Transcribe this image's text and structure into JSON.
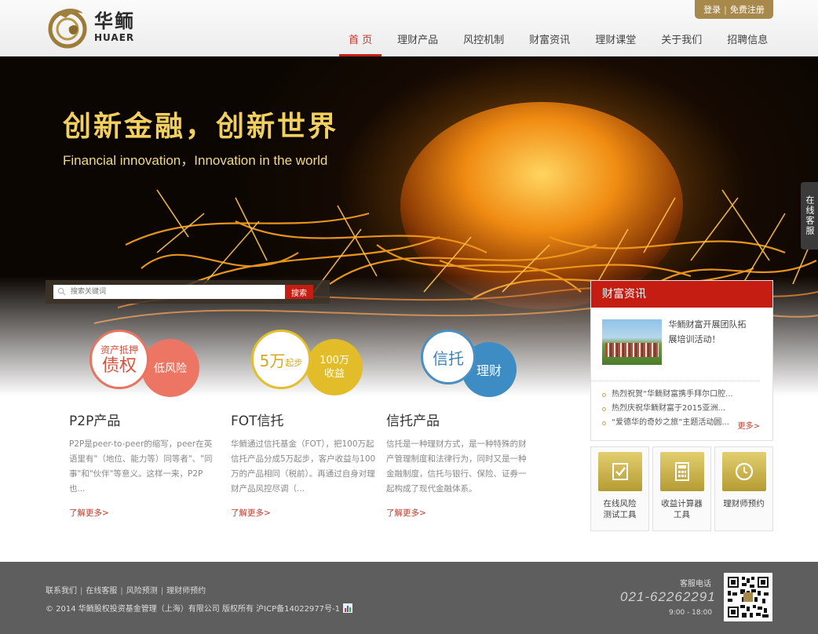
{
  "brand": {
    "name_cn": "华鲕",
    "name_en": "HUAER"
  },
  "auth": {
    "login": "登录",
    "separator": "|",
    "register": "免费注册"
  },
  "nav": [
    {
      "label": "首 页",
      "active": true
    },
    {
      "label": "理财产品"
    },
    {
      "label": "风控机制"
    },
    {
      "label": "财富资讯"
    },
    {
      "label": "理财课堂"
    },
    {
      "label": "关于我们"
    },
    {
      "label": "招聘信息"
    }
  ],
  "banner": {
    "title": "创新金融，创新世界",
    "subtitle": "Financial innovation，Innovation in the world"
  },
  "side_service": {
    "label": "在线客服"
  },
  "search": {
    "placeholder": "搜索关键词",
    "button": "搜索"
  },
  "products": [
    {
      "badge_outline_top": "资产抵押",
      "badge_outline_main": "债权",
      "badge_fill": "低风险",
      "title": "P2P产品",
      "description": "P2P是peer-to-peer的缩写，peer在英语里有\"（地位、能力等）同等者\"、\"同事\"和\"伙伴\"等意义。这样一来，P2P也...",
      "more": "了解更多>",
      "colors": {
        "outline": "#e8745f",
        "fill": "#ec7563",
        "text": "#d9503c"
      }
    },
    {
      "badge_outline_main": "5万",
      "badge_outline_suffix": "起步",
      "badge_fill": "100万\n收益",
      "title": "FOT信托",
      "description": "华鲕通过信托基金（FOT），把100万起信托产品分成5万起步，客户收益与100万的产品相同（税前）。再通过自身对理财产品风控尽调（...",
      "more": "了解更多>",
      "colors": {
        "outline": "#e3bf2c",
        "fill": "#e2bd29",
        "text": "#d4a920"
      }
    },
    {
      "badge_outline_main": "信托",
      "badge_fill": "理财",
      "title": "信托产品",
      "description": "信托是一种理财方式，是一种特殊的财产管理制度和法律行为，同时又是一种金融制度，信托与银行、保险、证券一起构成了现代金融体系。",
      "more": "了解更多>",
      "colors": {
        "outline": "#4a8fc2",
        "fill": "#3e8cc4",
        "text": "#3a83bb"
      }
    }
  ],
  "news": {
    "heading": "财富资讯",
    "feature": "华鲕财富开展团队拓展培训活动！",
    "items": [
      "热烈祝贺“华鲕财富携手拜尔口腔...",
      "热烈庆祝华鲕财富于2015亚洲...",
      "“爱德华的奇妙之旅”主题活动圆..."
    ],
    "more": "更多>"
  },
  "tools": [
    {
      "label_line1": "在线风险",
      "label_line2": "测试工具"
    },
    {
      "label_line1": "收益计算器",
      "label_line2": "工具"
    },
    {
      "label_line1": "理财师预约",
      "label_line2": ""
    }
  ],
  "footer": {
    "links": [
      "联系我们",
      "在线客服",
      "风险预测",
      "理财师预约"
    ],
    "link_separator": "|",
    "copyright": "© 2014 华鲕股权投资基金管理（上海）有限公司 版权所有 沪ICP备14022977号-1",
    "hotline_label": "客服电话",
    "hotline": "021-62262291",
    "hours": "9:00 - 18:00"
  },
  "colors": {
    "accent_red": "#c51d12",
    "gold": "#a7894c",
    "footer_bg": "#5e5e5e"
  }
}
